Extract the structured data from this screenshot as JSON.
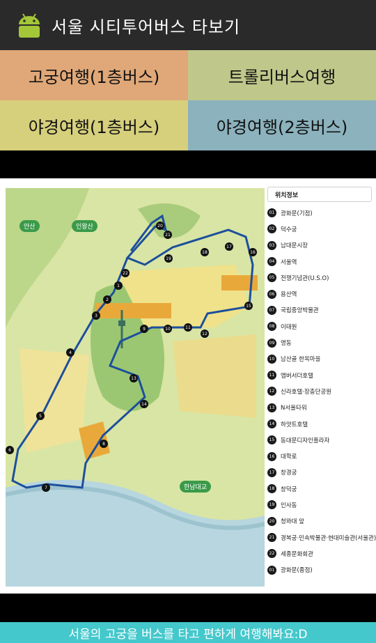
{
  "app": {
    "title": "서울 시티투어버스 타보기",
    "icon": "android-robot-icon"
  },
  "routes": [
    {
      "label": "고궁여행(1층버스)",
      "color": "#e0a878"
    },
    {
      "label": "트롤리버스여행",
      "color": "#bfc88a"
    },
    {
      "label": "야경여행(1층버스)",
      "color": "#d6cf7c"
    },
    {
      "label": "야경여행(2층버스)",
      "color": "#8bb2bd"
    }
  ],
  "map": {
    "labels": {
      "ansan": "안산",
      "inwangsan": "인왕산",
      "hannam": "한남대교"
    },
    "stop_numbers": [
      "1",
      "2",
      "3",
      "4",
      "5",
      "6",
      "7",
      "8",
      "9",
      "10",
      "11",
      "12",
      "13",
      "14",
      "15",
      "16",
      "17",
      "18",
      "19",
      "20",
      "21",
      "22"
    ]
  },
  "legend": {
    "header": "위치정보",
    "items": [
      {
        "num": "01",
        "name": "광화문(기점)"
      },
      {
        "num": "02",
        "name": "덕수궁"
      },
      {
        "num": "03",
        "name": "남대문시장"
      },
      {
        "num": "04",
        "name": "서울역"
      },
      {
        "num": "05",
        "name": "전쟁기념관(U.S.O)"
      },
      {
        "num": "06",
        "name": "용산역"
      },
      {
        "num": "07",
        "name": "국립중앙박물관"
      },
      {
        "num": "08",
        "name": "이태원"
      },
      {
        "num": "09",
        "name": "명동"
      },
      {
        "num": "10",
        "name": "남산골 한옥마을"
      },
      {
        "num": "11",
        "name": "앰버서더호텔"
      },
      {
        "num": "12",
        "name": "신라호텔·장충단공원"
      },
      {
        "num": "13",
        "name": "N서울타워"
      },
      {
        "num": "14",
        "name": "하얏트호텔"
      },
      {
        "num": "15",
        "name": "동대문디자인플라자"
      },
      {
        "num": "16",
        "name": "대학로"
      },
      {
        "num": "17",
        "name": "창경궁"
      },
      {
        "num": "18",
        "name": "창덕궁"
      },
      {
        "num": "19",
        "name": "인사동"
      },
      {
        "num": "20",
        "name": "청와대 앞"
      },
      {
        "num": "21",
        "name": "경복궁·민속박물관·현대미술관(서울관)"
      },
      {
        "num": "22",
        "name": "세종문화회관"
      },
      {
        "num": "01",
        "name": "광화문(종점)"
      }
    ]
  },
  "banner": {
    "text": "서울의 고궁을 버스를 타고 편하게 여행해봐요:D"
  }
}
